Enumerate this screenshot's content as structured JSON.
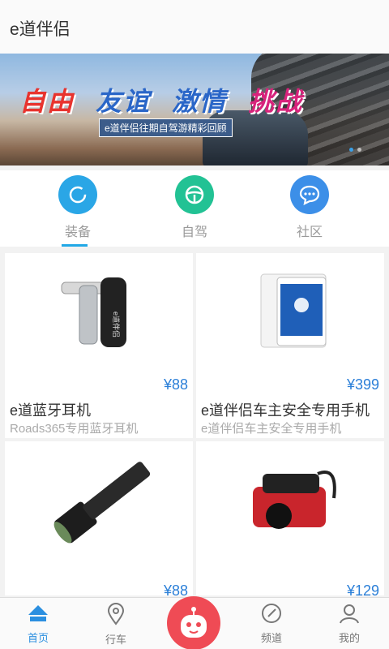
{
  "header": {
    "title": "e道伴侣"
  },
  "banner": {
    "slogan": [
      "自由",
      "友谊",
      "激情",
      "挑战"
    ],
    "slogan_colors": [
      "#e8332e",
      "#2a66c8",
      "#2a66c8",
      "#d8237c"
    ],
    "subtitle": "e道伴侣往期自驾游精彩回顾"
  },
  "tabs": [
    {
      "label": "装备",
      "icon": "ring-icon",
      "color": "#2aa6e6"
    },
    {
      "label": "自驾",
      "icon": "steering-wheel-icon",
      "color": "#22c294"
    },
    {
      "label": "社区",
      "icon": "chat-bubble-icon",
      "color": "#3c8fe8"
    }
  ],
  "products": [
    {
      "price": "¥88",
      "name": "e道蓝牙耳机",
      "desc": "Roads365专用蓝牙耳机",
      "icon": "bluetooth-headset-icon"
    },
    {
      "price": "¥399",
      "name": "e道伴侣车主安全专用手机",
      "desc": "e道伴侣车主安全专用手机",
      "icon": "smartphone-icon"
    },
    {
      "price": "¥88",
      "name": "",
      "desc": "",
      "icon": "flashlight-icon"
    },
    {
      "price": "¥129",
      "name": "",
      "desc": "",
      "icon": "air-compressor-icon"
    }
  ],
  "bottom_nav": [
    {
      "label": "首页",
      "icon": "home-icon"
    },
    {
      "label": "行车",
      "icon": "location-pin-icon"
    },
    {
      "label": "",
      "icon": "robot-icon"
    },
    {
      "label": "频道",
      "icon": "compass-icon"
    },
    {
      "label": "我的",
      "icon": "user-icon"
    }
  ],
  "colors": {
    "accent": "#21a8e6",
    "price": "#2b7fd8",
    "robot": "#ef4b55"
  }
}
